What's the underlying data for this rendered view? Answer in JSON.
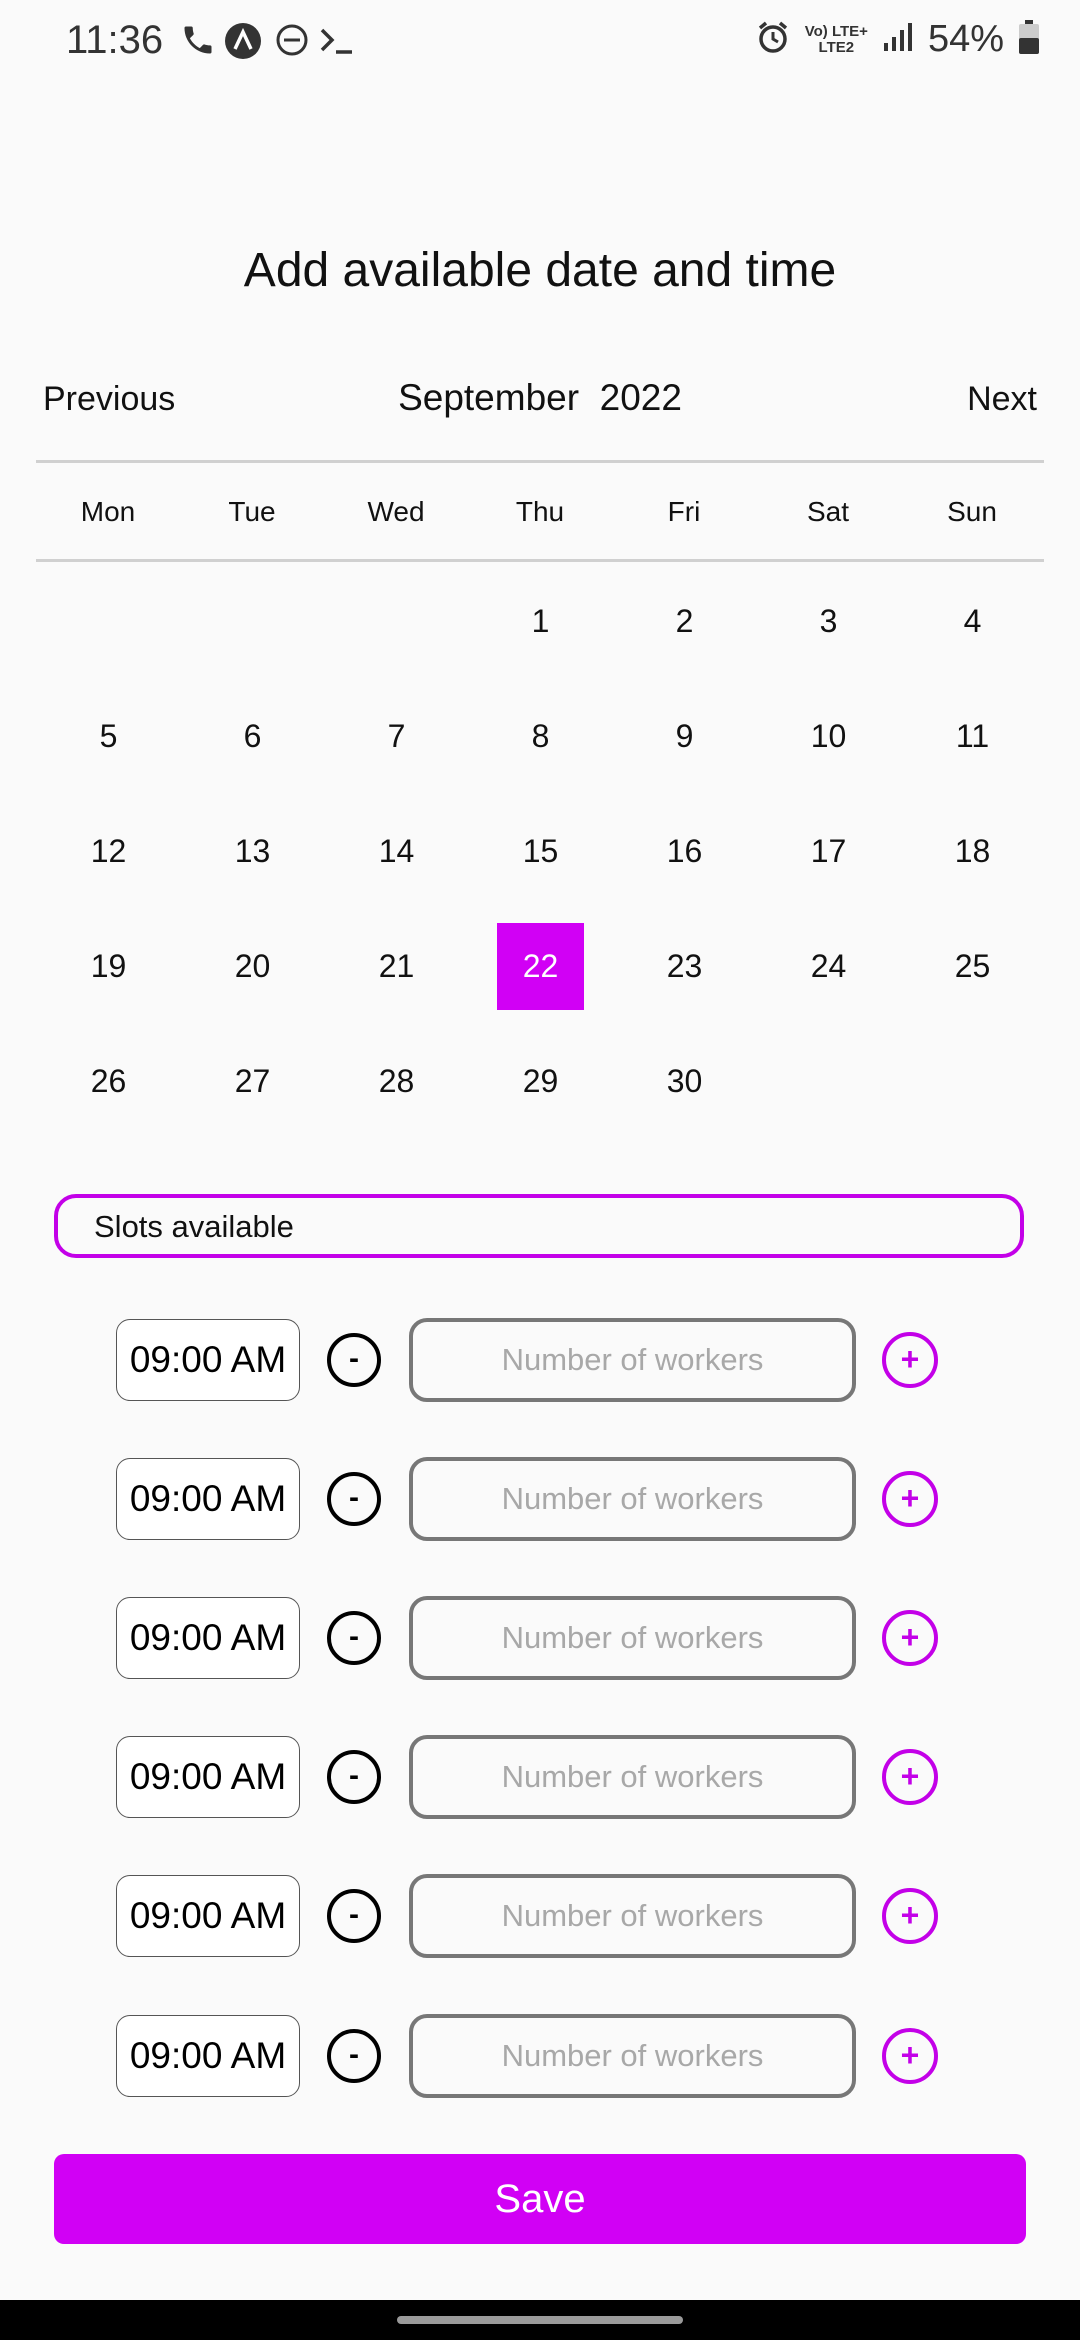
{
  "status_bar": {
    "time": "11:36",
    "network_top": "Vo) LTE+",
    "network_bottom": "LTE2",
    "battery": "54%",
    "icons": [
      "phone-icon",
      "app-icon",
      "dnd-icon",
      "terminal-icon",
      "alarm-icon",
      "signal-icon",
      "battery-icon"
    ]
  },
  "page": {
    "title": "Add available date and time"
  },
  "calendar": {
    "previous_label": "Previous",
    "next_label": "Next",
    "month_label": "September  2022",
    "weekdays": [
      "Mon",
      "Tue",
      "Wed",
      "Thu",
      "Fri",
      "Sat",
      "Sun"
    ],
    "days": [
      "1",
      "2",
      "3",
      "4",
      "5",
      "6",
      "7",
      "8",
      "9",
      "10",
      "11",
      "12",
      "13",
      "14",
      "15",
      "16",
      "17",
      "18",
      "19",
      "20",
      "21",
      "22",
      "23",
      "24",
      "25",
      "26",
      "27",
      "28",
      "29",
      "30"
    ],
    "selected_day": "22",
    "accent_color": "#d100f5"
  },
  "slots": {
    "header": "Slots available",
    "rows": [
      {
        "time": "09:00 AM",
        "minus": "-",
        "plus": "+",
        "workers_placeholder": "Number of workers"
      },
      {
        "time": "09:00 AM",
        "minus": "-",
        "plus": "+",
        "workers_placeholder": "Number of workers"
      },
      {
        "time": "09:00 AM",
        "minus": "-",
        "plus": "+",
        "workers_placeholder": "Number of workers"
      },
      {
        "time": "09:00 AM",
        "minus": "-",
        "plus": "+",
        "workers_placeholder": "Number of workers"
      },
      {
        "time": "09:00 AM",
        "minus": "-",
        "plus": "+",
        "workers_placeholder": "Number of workers"
      },
      {
        "time": "09:00 AM",
        "minus": "-",
        "plus": "+",
        "workers_placeholder": "Number of workers"
      }
    ]
  },
  "footer": {
    "save_label": "Save"
  }
}
